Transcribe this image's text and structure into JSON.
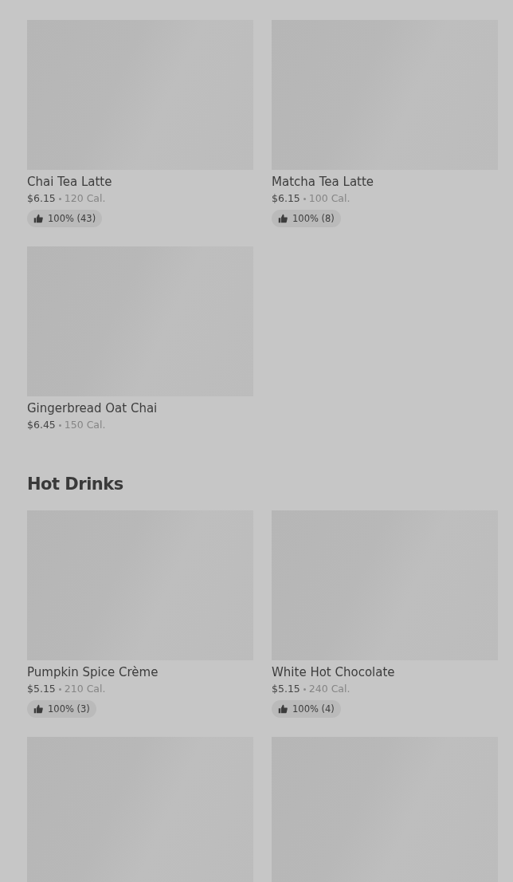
{
  "sections": [
    {
      "items": [
        {
          "kind": "item",
          "name": "Chai Tea Latte",
          "price": "$6.15",
          "calories": "120 Cal.",
          "rating": "100% (43)"
        },
        {
          "kind": "item",
          "name": "Matcha Tea Latte",
          "price": "$6.15",
          "calories": "100 Cal.",
          "rating": "100% (8)"
        },
        {
          "kind": "item",
          "name": "Gingerbread Oat Chai",
          "price": "$6.45",
          "calories": "150 Cal."
        }
      ]
    },
    {
      "title": "Hot Drinks",
      "items": [
        {
          "kind": "item",
          "name": "Pumpkin Spice Crème",
          "price": "$5.15",
          "calories": "210 Cal.",
          "rating": "100% (3)"
        },
        {
          "kind": "item",
          "name": "White Hot Chocolate",
          "price": "$5.15",
          "calories": "240 Cal.",
          "rating": "100% (4)"
        },
        {
          "kind": "picture"
        },
        {
          "kind": "picture"
        }
      ]
    }
  ]
}
